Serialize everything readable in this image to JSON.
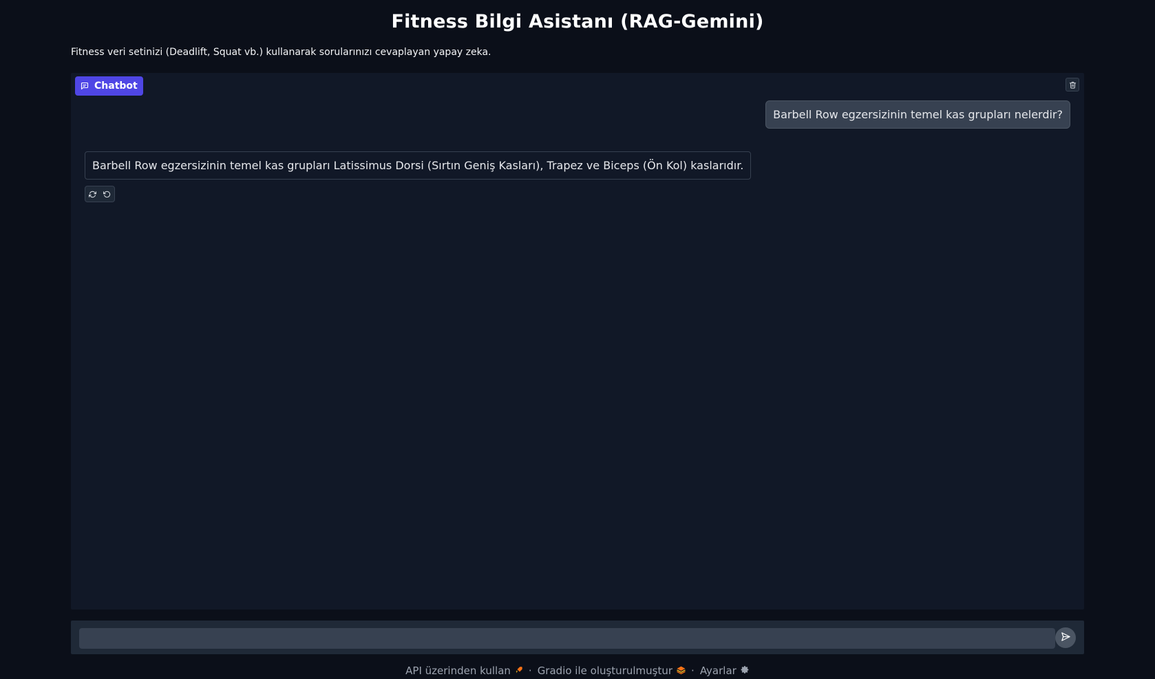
{
  "header": {
    "title": "Fitness Bilgi Asistanı (RAG-Gemini)",
    "description": "Fitness veri setinizi (Deadlift, Squat vb.) kullanarak sorularınızı cevaplayan yapay zeka."
  },
  "chatbot": {
    "label": "Chatbot",
    "label_icon": "chat-bubble-icon",
    "clear_icon": "trash-icon",
    "messages": [
      {
        "role": "user",
        "text": "Barbell Row egzersizinin temel kas grupları nelerdir?"
      },
      {
        "role": "bot",
        "text": "Barbell Row egzersizinin temel kas grupları Latissimus Dorsi (Sırtın Geniş Kasları), Trapez ve Biceps (Ön Kol) kaslarıdır."
      }
    ],
    "actions": [
      {
        "icon": "retry-icon"
      },
      {
        "icon": "undo-icon"
      }
    ]
  },
  "input": {
    "value": "",
    "placeholder": "",
    "send_icon": "send-icon"
  },
  "footer": {
    "api_label": "API üzerinden kullan",
    "gradio_label": "Gradio ile oluşturulmuştur",
    "settings_label": "Ayarlar",
    "separator": "·"
  },
  "colors": {
    "background": "#0b0f19",
    "panel": "#111827",
    "accent": "#4f46e5",
    "user_bubble": "#374151"
  }
}
